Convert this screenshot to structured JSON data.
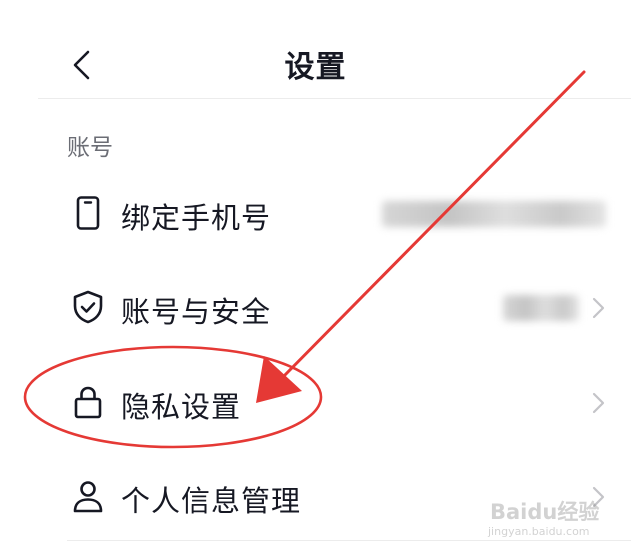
{
  "header": {
    "title": "设置"
  },
  "account_section": {
    "label": "账号",
    "items": [
      {
        "label": "绑定手机号",
        "icon": "phone-icon"
      },
      {
        "label": "账号与安全",
        "icon": "shield-check-icon"
      },
      {
        "label": "隐私设置",
        "icon": "lock-icon"
      },
      {
        "label": "个人信息管理",
        "icon": "person-icon"
      }
    ]
  },
  "annotation": {
    "color": "#e53935"
  },
  "watermark": {
    "text": "Baidu经验",
    "url": "jingyan.baidu.com"
  }
}
